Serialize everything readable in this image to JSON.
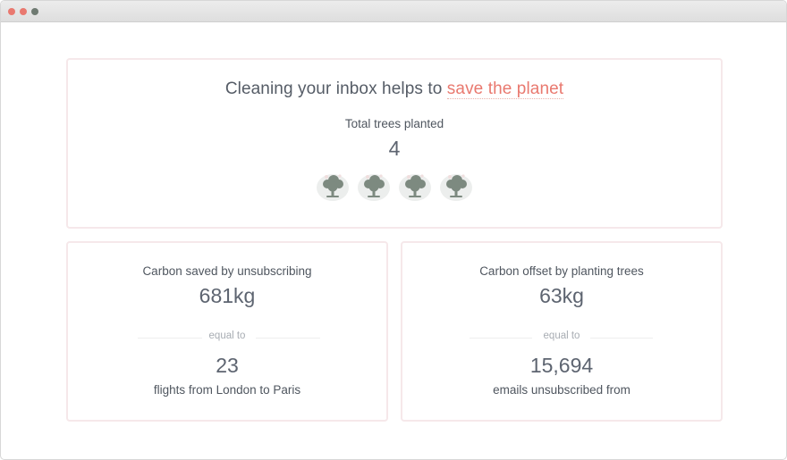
{
  "header": {
    "headline_prefix": "Cleaning your inbox helps to",
    "headline_highlight": "save the planet"
  },
  "trees": {
    "label": "Total trees planted",
    "count": "4",
    "icons": [
      "tree-icon",
      "tree-icon",
      "tree-icon",
      "tree-icon"
    ]
  },
  "carbon_saved": {
    "title": "Carbon saved by unsubscribing",
    "value": "681kg",
    "divider": "equal to",
    "equivalent_value": "23",
    "equivalent_label": "flights from London to Paris"
  },
  "carbon_offset": {
    "title": "Carbon offset by planting trees",
    "value": "63kg",
    "divider": "equal to",
    "equivalent_value": "15,694",
    "equivalent_label": "emails unsubscribed from"
  },
  "colors": {
    "accent": "#e9796f",
    "tree": "#7d8a80",
    "card_border": "#f6e8ea"
  }
}
